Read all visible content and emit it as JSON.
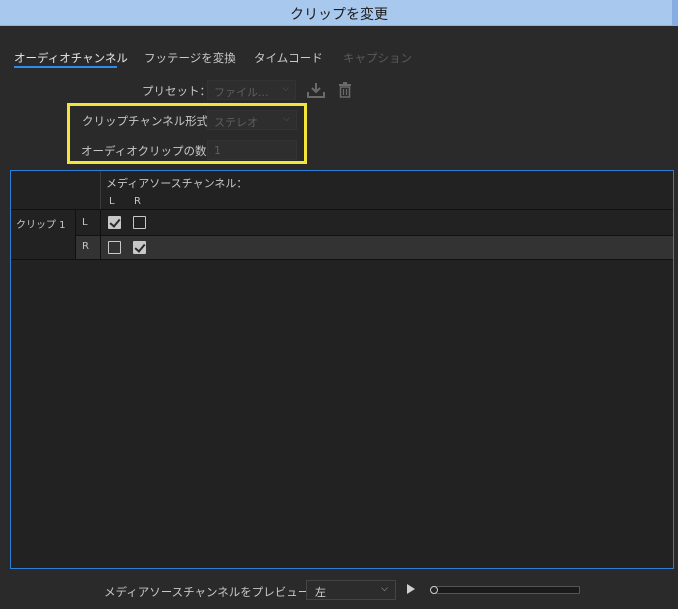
{
  "window": {
    "title": "クリップを変更"
  },
  "tabs": [
    {
      "label": "オーディオチャンネル",
      "state": "active"
    },
    {
      "label": "フッテージを変換",
      "state": "normal"
    },
    {
      "label": "タイムコード",
      "state": "normal"
    },
    {
      "label": "キャプション",
      "state": "disabled"
    }
  ],
  "preset": {
    "label": "プリセット：",
    "value": "ファイル...",
    "icons": [
      "download-icon",
      "trash-icon"
    ]
  },
  "clip_channel_format": {
    "label": "クリップチャンネル形式：",
    "value": "ステレオ"
  },
  "audio_clip_count": {
    "label": "オーディオクリップの数：",
    "value": "1"
  },
  "grid": {
    "header": "メディアソースチャンネル：",
    "columns": [
      "L",
      "R"
    ],
    "clip_label": "クリップ 1",
    "rows": [
      {
        "channel": "L",
        "checks": [
          true,
          false
        ]
      },
      {
        "channel": "R",
        "checks": [
          false,
          true
        ]
      }
    ]
  },
  "footer": {
    "preview_label": "メディアソースチャンネルをプレビュー：",
    "preview_value": "左"
  },
  "colors": {
    "accent": "#2d8ceb",
    "highlight": "#f3e43b",
    "titlebar": "#a9c8ee"
  }
}
